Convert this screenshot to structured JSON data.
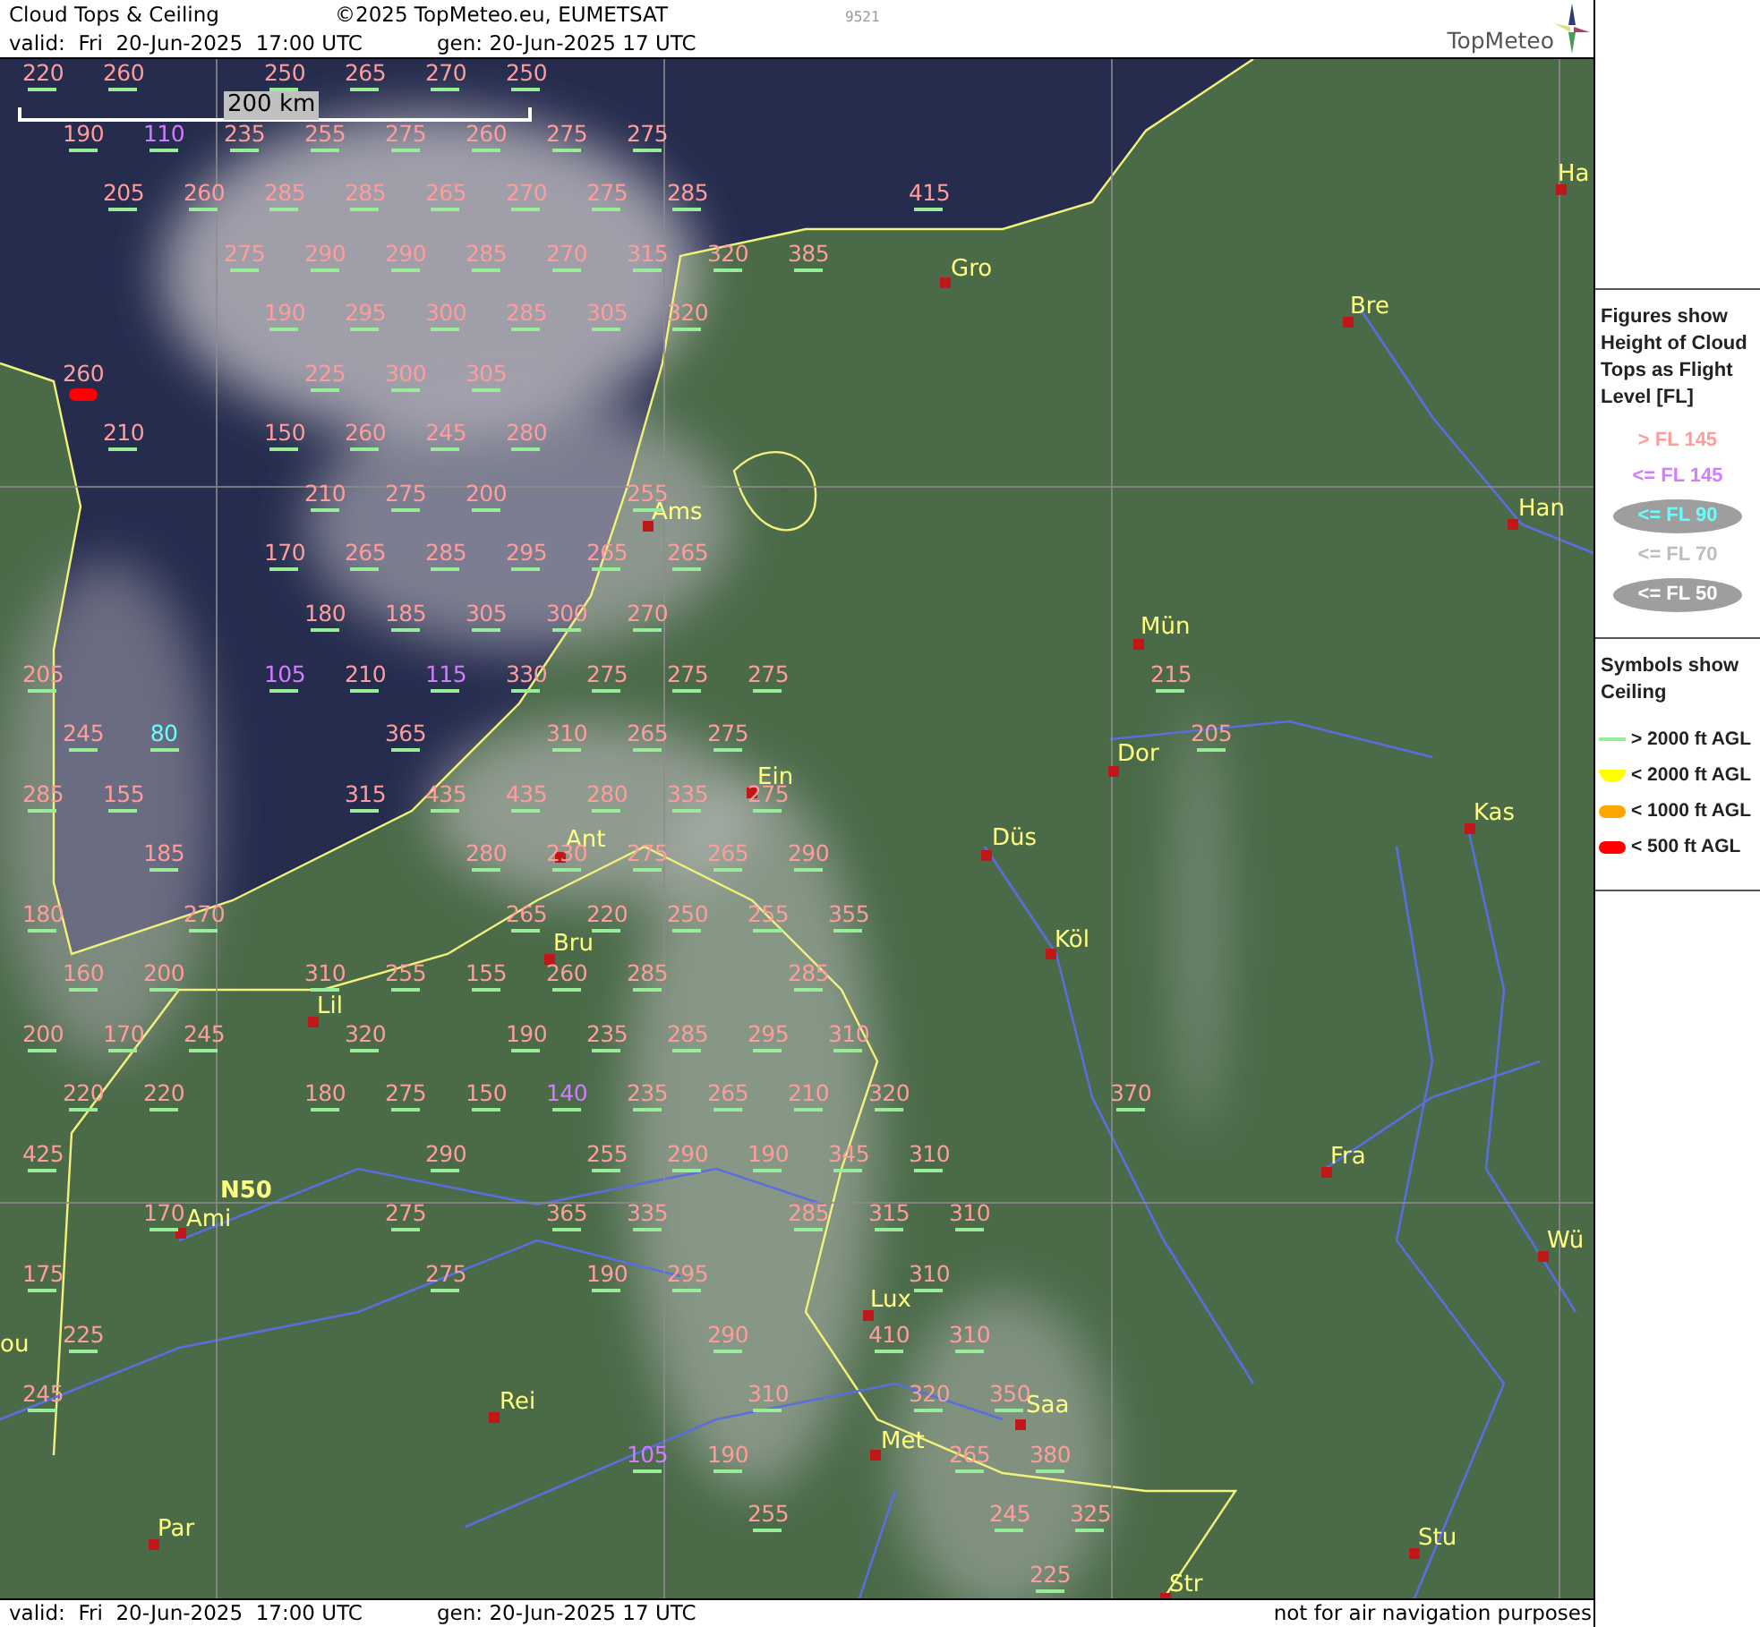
{
  "header": {
    "title": "Cloud Tops & Ceiling",
    "copyright": "©2025 TopMeteo.eu, EUMETSAT",
    "code": "9521",
    "valid": "valid:  Fri  20-Jun-2025  17:00 UTC",
    "generated": "gen: 20-Jun-2025 17 UTC",
    "logo": "TopMeteo"
  },
  "scale_bar": {
    "label": "200 km"
  },
  "cloud_tops": {
    "rows": [
      [
        {
          "value": "220",
          "color": "#ff9c9c",
          "kind": "high"
        },
        {
          "value": "260",
          "color": "#ff9c9c",
          "kind": "high"
        },
        null,
        {
          "value": "250",
          "color": "#ff9c9c",
          "kind": "high"
        },
        {
          "value": "265",
          "color": "#ff9c9c",
          "kind": "high"
        },
        {
          "value": "270",
          "color": "#ff9c9c",
          "kind": "high"
        },
        {
          "value": "250",
          "color": "#ff9c9c",
          "kind": "high"
        }
      ],
      [
        {
          "value": "190",
          "color": "#ff9c9c",
          "kind": "high"
        },
        {
          "value": "110",
          "color": "#d47cff",
          "kind": "high"
        },
        {
          "value": "235",
          "color": "#ff9c9c",
          "kind": "high"
        },
        {
          "value": "255",
          "color": "#ff9c9c",
          "kind": "high"
        },
        {
          "value": "275",
          "color": "#ff9c9c",
          "kind": "high"
        },
        {
          "value": "260",
          "color": "#ff9c9c",
          "kind": "high"
        },
        {
          "value": "275",
          "color": "#ff9c9c",
          "kind": "high"
        },
        {
          "value": "275",
          "color": "#ff9c9c",
          "kind": "high"
        }
      ],
      [
        null,
        {
          "value": "205",
          "color": "#ff9c9c",
          "kind": "high"
        },
        {
          "value": "260",
          "color": "#ff9c9c",
          "kind": "high"
        },
        {
          "value": "285",
          "color": "#ff9c9c",
          "kind": "high"
        },
        {
          "value": "285",
          "color": "#ff9c9c",
          "kind": "high"
        },
        {
          "value": "265",
          "color": "#ff9c9c",
          "kind": "high"
        },
        {
          "value": "270",
          "color": "#ff9c9c",
          "kind": "high"
        },
        {
          "value": "275",
          "color": "#ff9c9c",
          "kind": "high"
        },
        {
          "value": "285",
          "color": "#ff9c9c",
          "kind": "high"
        },
        null,
        null,
        {
          "value": "415",
          "color": "#ff9c9c",
          "kind": "high"
        }
      ],
      [
        null,
        null,
        {
          "value": "275",
          "color": "#ff9c9c",
          "kind": "high"
        },
        {
          "value": "290",
          "color": "#ff9c9c",
          "kind": "high"
        },
        {
          "value": "290",
          "color": "#ff9c9c",
          "kind": "high"
        },
        {
          "value": "285",
          "color": "#ff9c9c",
          "kind": "high"
        },
        {
          "value": "270",
          "color": "#ff9c9c",
          "kind": "high"
        },
        {
          "value": "315",
          "color": "#ff9c9c",
          "kind": "high"
        },
        {
          "value": "320",
          "color": "#ff9c9c",
          "kind": "high"
        },
        {
          "value": "385",
          "color": "#ff9c9c",
          "kind": "high"
        }
      ],
      [
        null,
        null,
        null,
        {
          "value": "190",
          "color": "#ff9c9c",
          "kind": "high"
        },
        {
          "value": "295",
          "color": "#ff9c9c",
          "kind": "high"
        },
        {
          "value": "300",
          "color": "#ff9c9c",
          "kind": "high"
        },
        {
          "value": "285",
          "color": "#ff9c9c",
          "kind": "high"
        },
        {
          "value": "305",
          "color": "#ff9c9c",
          "kind": "high"
        },
        {
          "value": "320",
          "color": "#ff9c9c",
          "kind": "high"
        }
      ],
      [
        {
          "value": "260",
          "color": "#ff9c9c",
          "kind": "lt500"
        },
        null,
        null,
        {
          "value": "225",
          "color": "#ff9c9c",
          "kind": "high"
        },
        {
          "value": "300",
          "color": "#ff9c9c",
          "kind": "high"
        },
        {
          "value": "305",
          "color": "#ff9c9c",
          "kind": "high"
        }
      ],
      [
        null,
        {
          "value": "210",
          "color": "#ff9c9c",
          "kind": "high"
        },
        null,
        {
          "value": "150",
          "color": "#ff9c9c",
          "kind": "high"
        },
        {
          "value": "260",
          "color": "#ff9c9c",
          "kind": "high"
        },
        {
          "value": "245",
          "color": "#ff9c9c",
          "kind": "high"
        },
        {
          "value": "280",
          "color": "#ff9c9c",
          "kind": "high"
        }
      ],
      [
        null,
        null,
        null,
        {
          "value": "210",
          "color": "#ff9c9c",
          "kind": "high"
        },
        {
          "value": "275",
          "color": "#ff9c9c",
          "kind": "high"
        },
        {
          "value": "200",
          "color": "#ff9c9c",
          "kind": "high"
        },
        null,
        {
          "value": "255",
          "color": "#ff9c9c",
          "kind": "high"
        }
      ],
      [
        null,
        null,
        null,
        {
          "value": "170",
          "color": "#ff9c9c",
          "kind": "high"
        },
        {
          "value": "265",
          "color": "#ff9c9c",
          "kind": "high"
        },
        {
          "value": "285",
          "color": "#ff9c9c",
          "kind": "high"
        },
        {
          "value": "295",
          "color": "#ff9c9c",
          "kind": "high"
        },
        {
          "value": "265",
          "color": "#ff9c9c",
          "kind": "high"
        },
        {
          "value": "265",
          "color": "#ff9c9c",
          "kind": "high"
        }
      ],
      [
        null,
        null,
        null,
        {
          "value": "180",
          "color": "#ff9c9c",
          "kind": "high"
        },
        {
          "value": "185",
          "color": "#ff9c9c",
          "kind": "high"
        },
        {
          "value": "305",
          "color": "#ff9c9c",
          "kind": "high"
        },
        {
          "value": "300",
          "color": "#ff9c9c",
          "kind": "high"
        },
        {
          "value": "270",
          "color": "#ff9c9c",
          "kind": "high"
        }
      ],
      [
        {
          "value": "205",
          "color": "#ff9c9c",
          "kind": "high"
        },
        null,
        null,
        {
          "value": "105",
          "color": "#d47cff",
          "kind": "high"
        },
        {
          "value": "210",
          "color": "#ff9c9c",
          "kind": "high"
        },
        {
          "value": "115",
          "color": "#d47cff",
          "kind": "high"
        },
        {
          "value": "330",
          "color": "#ff9c9c",
          "kind": "high"
        },
        {
          "value": "275",
          "color": "#ff9c9c",
          "kind": "high"
        },
        {
          "value": "275",
          "color": "#ff9c9c",
          "kind": "high"
        },
        {
          "value": "275",
          "color": "#ff9c9c",
          "kind": "high"
        },
        null,
        null,
        null,
        null,
        {
          "value": "215",
          "color": "#ff9c9c",
          "kind": "high"
        }
      ],
      [
        {
          "value": "245",
          "color": "#ff9c9c",
          "kind": "high"
        },
        {
          "value": "80",
          "color": "#66ffff",
          "kind": "high"
        },
        null,
        null,
        {
          "value": "365",
          "color": "#ff9c9c",
          "kind": "high"
        },
        null,
        {
          "value": "310",
          "color": "#ff9c9c",
          "kind": "high"
        },
        {
          "value": "265",
          "color": "#ff9c9c",
          "kind": "high"
        },
        {
          "value": "275",
          "color": "#ff9c9c",
          "kind": "high"
        },
        null,
        null,
        null,
        null,
        null,
        {
          "value": "205",
          "color": "#ff9c9c",
          "kind": "high"
        }
      ],
      [
        {
          "value": "285",
          "color": "#ff9c9c",
          "kind": "high"
        },
        {
          "value": "155",
          "color": "#ff9c9c",
          "kind": "high"
        },
        null,
        null,
        {
          "value": "315",
          "color": "#ff9c9c",
          "kind": "high"
        },
        {
          "value": "435",
          "color": "#ff9c9c",
          "kind": "high"
        },
        {
          "value": "435",
          "color": "#ff9c9c",
          "kind": "high"
        },
        {
          "value": "280",
          "color": "#ff9c9c",
          "kind": "high"
        },
        {
          "value": "335",
          "color": "#ff9c9c",
          "kind": "high"
        },
        {
          "value": "275",
          "color": "#ff9c9c",
          "kind": "high"
        }
      ],
      [
        null,
        {
          "value": "185",
          "color": "#ff9c9c",
          "kind": "high"
        },
        null,
        null,
        null,
        {
          "value": "280",
          "color": "#ff9c9c",
          "kind": "high"
        },
        {
          "value": "230",
          "color": "#ff9c9c",
          "kind": "high"
        },
        {
          "value": "275",
          "color": "#ff9c9c",
          "kind": "high"
        },
        {
          "value": "265",
          "color": "#ff9c9c",
          "kind": "high"
        },
        {
          "value": "290",
          "color": "#ff9c9c",
          "kind": "high"
        }
      ],
      [
        {
          "value": "180",
          "color": "#ff9c9c",
          "kind": "high"
        },
        null,
        {
          "value": "270",
          "color": "#ff9c9c",
          "kind": "high"
        },
        null,
        null,
        null,
        {
          "value": "265",
          "color": "#ff9c9c",
          "kind": "high"
        },
        {
          "value": "220",
          "color": "#ff9c9c",
          "kind": "high"
        },
        {
          "value": "250",
          "color": "#ff9c9c",
          "kind": "high"
        },
        {
          "value": "255",
          "color": "#ff9c9c",
          "kind": "high"
        },
        {
          "value": "355",
          "color": "#ff9c9c",
          "kind": "high"
        }
      ],
      [
        {
          "value": "160",
          "color": "#ff9c9c",
          "kind": "high"
        },
        {
          "value": "200",
          "color": "#ff9c9c",
          "kind": "high"
        },
        null,
        {
          "value": "310",
          "color": "#ff9c9c",
          "kind": "high"
        },
        {
          "value": "255",
          "color": "#ff9c9c",
          "kind": "high"
        },
        {
          "value": "155",
          "color": "#ff9c9c",
          "kind": "high"
        },
        {
          "value": "260",
          "color": "#ff9c9c",
          "kind": "high"
        },
        {
          "value": "285",
          "color": "#ff9c9c",
          "kind": "high"
        },
        null,
        {
          "value": "285",
          "color": "#ff9c9c",
          "kind": "high"
        }
      ],
      [
        {
          "value": "200",
          "color": "#ff9c9c",
          "kind": "high"
        },
        {
          "value": "170",
          "color": "#ff9c9c",
          "kind": "high"
        },
        {
          "value": "245",
          "color": "#ff9c9c",
          "kind": "high"
        },
        null,
        {
          "value": "320",
          "color": "#ff9c9c",
          "kind": "high"
        },
        null,
        {
          "value": "190",
          "color": "#ff9c9c",
          "kind": "high"
        },
        {
          "value": "235",
          "color": "#ff9c9c",
          "kind": "high"
        },
        {
          "value": "285",
          "color": "#ff9c9c",
          "kind": "high"
        },
        {
          "value": "295",
          "color": "#ff9c9c",
          "kind": "high"
        },
        {
          "value": "310",
          "color": "#ff9c9c",
          "kind": "high"
        }
      ],
      [
        {
          "value": "220",
          "color": "#ff9c9c",
          "kind": "high"
        },
        {
          "value": "220",
          "color": "#ff9c9c",
          "kind": "high"
        },
        null,
        {
          "value": "180",
          "color": "#ff9c9c",
          "kind": "high"
        },
        {
          "value": "275",
          "color": "#ff9c9c",
          "kind": "high"
        },
        {
          "value": "150",
          "color": "#ff9c9c",
          "kind": "high"
        },
        {
          "value": "140",
          "color": "#d47cff",
          "kind": "high"
        },
        {
          "value": "235",
          "color": "#ff9c9c",
          "kind": "high"
        },
        {
          "value": "265",
          "color": "#ff9c9c",
          "kind": "high"
        },
        {
          "value": "210",
          "color": "#ff9c9c",
          "kind": "high"
        },
        {
          "value": "320",
          "color": "#ff9c9c",
          "kind": "high"
        },
        null,
        null,
        {
          "value": "370",
          "color": "#ff9c9c",
          "kind": "high"
        }
      ],
      [
        {
          "value": "425",
          "color": "#ff9c9c",
          "kind": "high"
        },
        null,
        null,
        null,
        null,
        {
          "value": "290",
          "color": "#ff9c9c",
          "kind": "high"
        },
        null,
        {
          "value": "255",
          "color": "#ff9c9c",
          "kind": "high"
        },
        {
          "value": "290",
          "color": "#ff9c9c",
          "kind": "high"
        },
        {
          "value": "190",
          "color": "#ff9c9c",
          "kind": "high"
        },
        {
          "value": "345",
          "color": "#ff9c9c",
          "kind": "high"
        },
        {
          "value": "310",
          "color": "#ff9c9c",
          "kind": "high"
        }
      ],
      [
        null,
        {
          "value": "170",
          "color": "#ff9c9c",
          "kind": "high"
        },
        null,
        null,
        {
          "value": "275",
          "color": "#ff9c9c",
          "kind": "high"
        },
        null,
        {
          "value": "365",
          "color": "#ff9c9c",
          "kind": "high"
        },
        {
          "value": "335",
          "color": "#ff9c9c",
          "kind": "high"
        },
        null,
        {
          "value": "285",
          "color": "#ff9c9c",
          "kind": "high"
        },
        {
          "value": "315",
          "color": "#ff9c9c",
          "kind": "high"
        },
        {
          "value": "310",
          "color": "#ff9c9c",
          "kind": "high"
        }
      ],
      [
        {
          "value": "175",
          "color": "#ff9c9c",
          "kind": "high"
        },
        null,
        null,
        null,
        null,
        {
          "value": "275",
          "color": "#ff9c9c",
          "kind": "high"
        },
        null,
        {
          "value": "190",
          "color": "#ff9c9c",
          "kind": "high"
        },
        {
          "value": "295",
          "color": "#ff9c9c",
          "kind": "high"
        },
        null,
        null,
        {
          "value": "310",
          "color": "#ff9c9c",
          "kind": "high"
        }
      ],
      [
        {
          "value": "225",
          "color": "#ff9c9c",
          "kind": "high"
        },
        null,
        null,
        null,
        null,
        null,
        null,
        null,
        {
          "value": "290",
          "color": "#ff9c9c",
          "kind": "high"
        },
        null,
        {
          "value": "410",
          "color": "#ff9c9c",
          "kind": "high"
        },
        {
          "value": "310",
          "color": "#ff9c9c",
          "kind": "high"
        }
      ],
      [
        {
          "value": "245",
          "color": "#ff9c9c",
          "kind": "high"
        },
        null,
        null,
        null,
        null,
        null,
        null,
        null,
        null,
        {
          "value": "310",
          "color": "#ff9c9c",
          "kind": "high"
        },
        null,
        {
          "value": "320",
          "color": "#ff9c9c",
          "kind": "high"
        },
        {
          "value": "350",
          "color": "#ff9c9c",
          "kind": "high"
        }
      ],
      [
        null,
        null,
        null,
        null,
        null,
        null,
        null,
        {
          "value": "105",
          "color": "#d47cff",
          "kind": "high"
        },
        {
          "value": "190",
          "color": "#ff9c9c",
          "kind": "high"
        },
        null,
        null,
        {
          "value": "265",
          "color": "#ff9c9c",
          "kind": "high"
        },
        {
          "value": "380",
          "color": "#ff9c9c",
          "kind": "high"
        }
      ],
      [
        null,
        null,
        null,
        null,
        null,
        null,
        null,
        null,
        null,
        {
          "value": "255",
          "color": "#ff9c9c",
          "kind": "high"
        },
        null,
        null,
        {
          "value": "245",
          "color": "#ff9c9c",
          "kind": "high"
        },
        {
          "value": "325",
          "color": "#ff9c9c",
          "kind": "high"
        }
      ],
      [
        null,
        null,
        null,
        null,
        null,
        null,
        null,
        null,
        null,
        null,
        null,
        null,
        {
          "value": "225",
          "color": "#ff9c9c",
          "kind": "high"
        }
      ]
    ]
  },
  "cities": [
    {
      "name": "Ha",
      "marker": true
    },
    {
      "name": "Gro",
      "marker": true
    },
    {
      "name": "Bre",
      "marker": true
    },
    {
      "name": "Han",
      "marker": true
    },
    {
      "name": "Ams",
      "marker": true
    },
    {
      "name": "Mün",
      "marker": true
    },
    {
      "name": "Dor",
      "marker": true
    },
    {
      "name": "Ein",
      "marker": true
    },
    {
      "name": "Kas",
      "marker": true
    },
    {
      "name": "Düs",
      "marker": true
    },
    {
      "name": "Ant",
      "marker": true
    },
    {
      "name": "Bru",
      "marker": true
    },
    {
      "name": "Köl",
      "marker": true
    },
    {
      "name": "Lil",
      "marker": true
    },
    {
      "name": "Fra",
      "marker": true
    },
    {
      "name": "Ami",
      "marker": true
    },
    {
      "name": "Wü",
      "marker": true
    },
    {
      "name": "Lux",
      "marker": true
    },
    {
      "name": "ou",
      "marker": false
    },
    {
      "name": "Rei",
      "marker": true
    },
    {
      "name": "Saa",
      "marker": true
    },
    {
      "name": "Met",
      "marker": true
    },
    {
      "name": "Par",
      "marker": true
    },
    {
      "name": "Stu",
      "marker": true
    },
    {
      "name": "Str",
      "marker": true
    }
  ],
  "grid_label": "N50",
  "figures_legend": {
    "title": "Figures show Height of Cloud Tops as Flight Level  [FL]",
    "items": [
      {
        "label": "> FL 145",
        "color": "#ff9c9c",
        "kind": "plain"
      },
      {
        "label": "<= FL 145",
        "color": "#d47cff",
        "kind": "plain"
      },
      {
        "label": "<= FL 90",
        "color": "#66ffff",
        "kind": "ellipse"
      },
      {
        "label": "<= FL 70",
        "color": "#bdbdbd",
        "kind": "plain"
      },
      {
        "label": "<= FL 50",
        "color": "#ffffff",
        "kind": "ellipse"
      }
    ]
  },
  "ceiling_legend": {
    "title": "Symbols show Ceiling",
    "items": [
      {
        "label": "> 2000 ft AGL",
        "kind": "high"
      },
      {
        "label": "< 2000 ft AGL",
        "kind": "lt2000"
      },
      {
        "label": "< 1000 ft AGL",
        "kind": "lt1000"
      },
      {
        "label": "< 500 ft AGL",
        "kind": "lt500"
      }
    ]
  },
  "footer": {
    "valid": "valid:  Fri  20-Jun-2025  17:00 UTC",
    "generated": "gen: 20-Jun-2025 17 UTC",
    "disclaimer": "not for air navigation purposes"
  }
}
